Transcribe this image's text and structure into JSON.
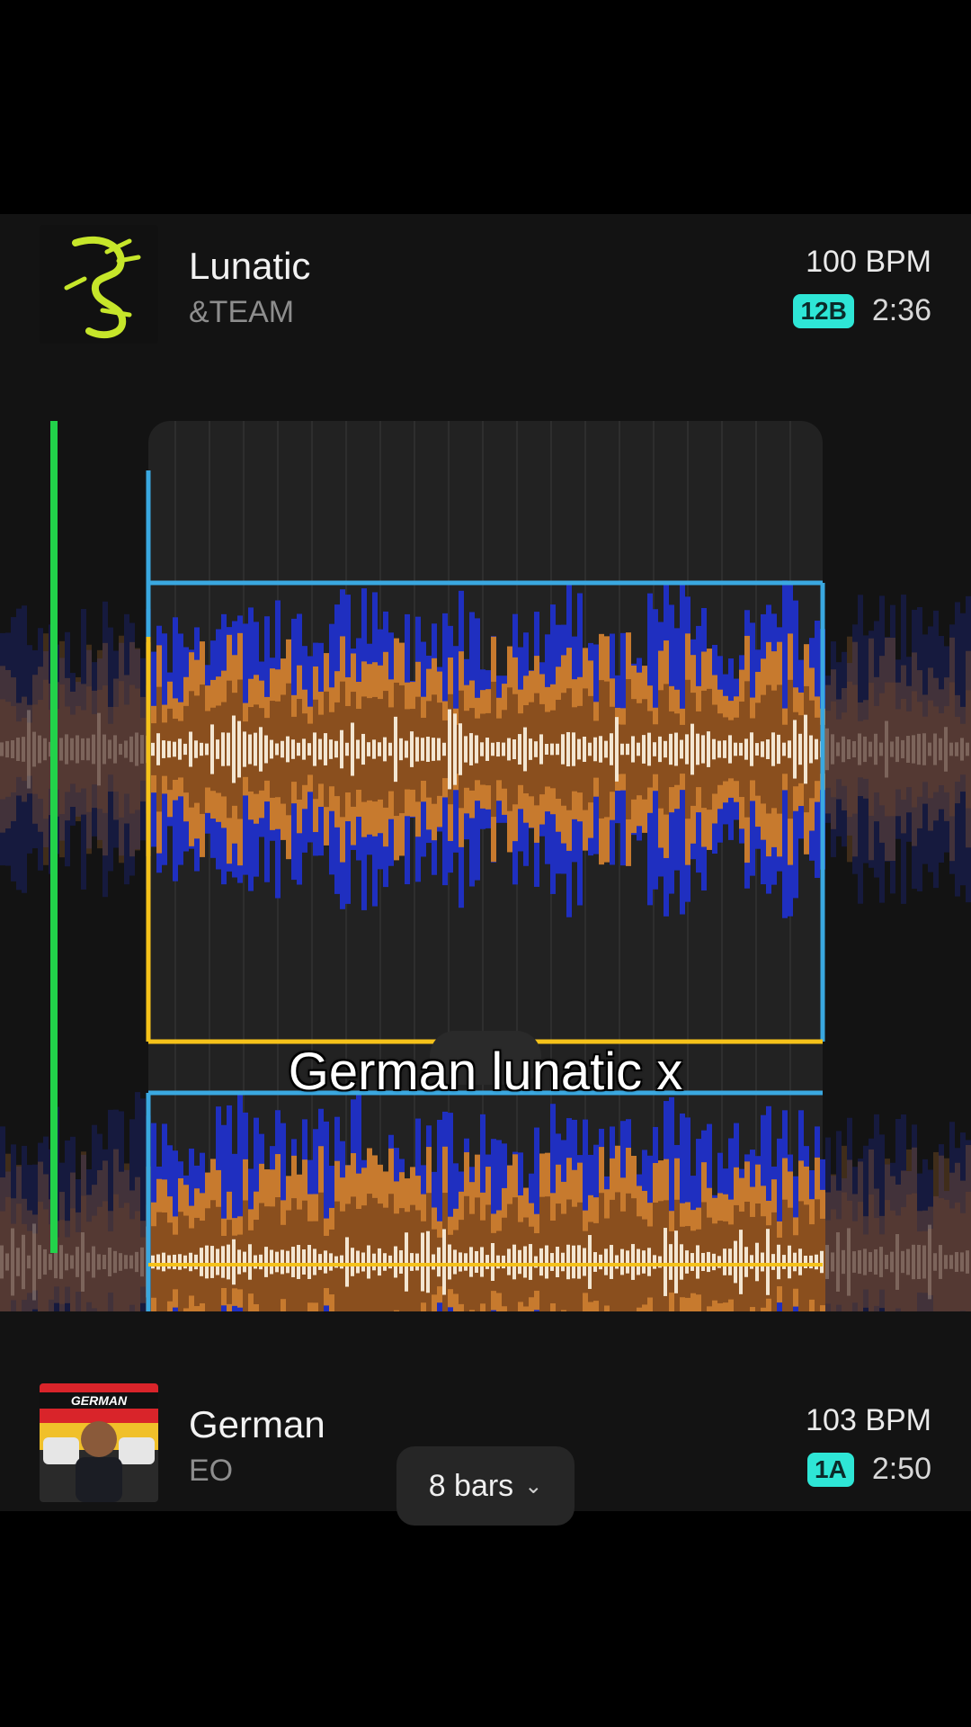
{
  "track_top": {
    "title": "Lunatic",
    "artist": "&TEAM",
    "bpm": "100 BPM",
    "key": "12B",
    "duration": "2:36",
    "key_color": "#2ee6d6"
  },
  "track_bottom": {
    "title": "German",
    "artist": "EO",
    "bpm": "103 BPM",
    "key": "1A",
    "duration": "2:50",
    "key_color": "#2ee6d6"
  },
  "overlay_caption": "German lunatic x",
  "loop_selector": {
    "label": "8 bars",
    "icon": "chevron-down-icon"
  },
  "colors": {
    "playhead": "#22d24a",
    "loop_in": "#3aa8e0",
    "loop_out": "#f5c21a",
    "wave_low": "#1f2fc0",
    "wave_mid": "#c77a2e",
    "wave_high": "#f3e6d2"
  }
}
